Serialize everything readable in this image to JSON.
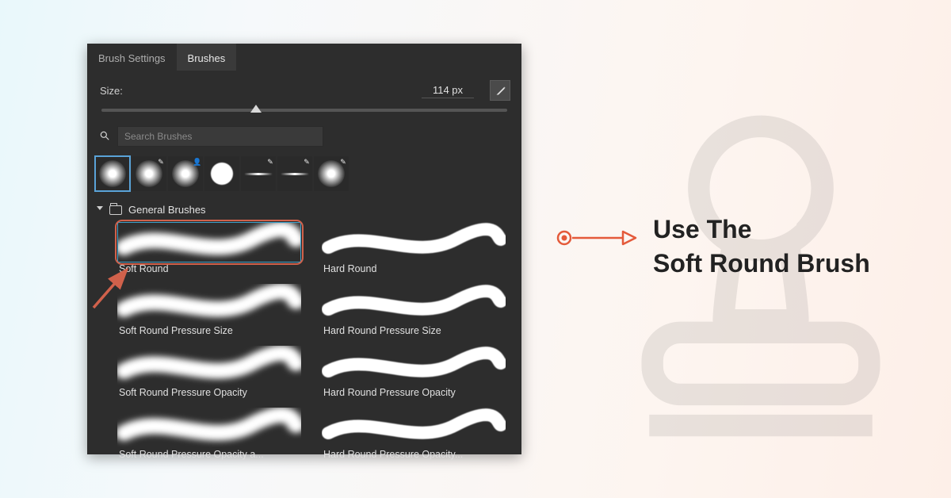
{
  "tabs": {
    "brush_settings": "Brush Settings",
    "brushes": "Brushes"
  },
  "size": {
    "label": "Size:",
    "value": "114 px"
  },
  "search": {
    "placeholder": "Search Brushes"
  },
  "recent_thumbs": [
    {
      "name": "soft-round-thumb",
      "shape": "soft",
      "selected": true,
      "badge": ""
    },
    {
      "name": "soft-round-pencil-thumb",
      "shape": "soft",
      "selected": false,
      "badge": "pencil"
    },
    {
      "name": "soft-round-large-thumb",
      "shape": "soft",
      "selected": false,
      "badge": "user"
    },
    {
      "name": "hard-round-thumb",
      "shape": "hard",
      "selected": false,
      "badge": ""
    },
    {
      "name": "thin-line-thumb",
      "shape": "line",
      "selected": false,
      "badge": "pencil"
    },
    {
      "name": "thin-line-thumb-2",
      "shape": "line",
      "selected": false,
      "badge": "pencil"
    },
    {
      "name": "soft-round-big-thumb",
      "shape": "soft",
      "selected": false,
      "badge": "pencil"
    }
  ],
  "folder": {
    "name": "General Brushes"
  },
  "brushes": [
    {
      "label": "Soft Round",
      "style": "soft",
      "highlighted": true
    },
    {
      "label": "Hard Round",
      "style": "hard",
      "highlighted": false
    },
    {
      "label": "Soft Round Pressure Size",
      "style": "soft",
      "highlighted": false
    },
    {
      "label": "Hard Round Pressure Size",
      "style": "hard",
      "highlighted": false
    },
    {
      "label": "Soft Round Pressure Opacity",
      "style": "soft",
      "highlighted": false
    },
    {
      "label": "Hard Round Pressure Opacity",
      "style": "hard",
      "highlighted": false
    },
    {
      "label": "Soft Round Pressure Opacity a...",
      "style": "soft",
      "highlighted": false
    },
    {
      "label": "Hard Round Pressure Opacity...",
      "style": "hard",
      "highlighted": false
    }
  ],
  "instruction": {
    "line1": "Use The",
    "line2": "Soft Round Brush"
  },
  "colors": {
    "accent": "#d0614b",
    "select": "#3fa0c8",
    "panel_bg": "#2d2d2d"
  }
}
